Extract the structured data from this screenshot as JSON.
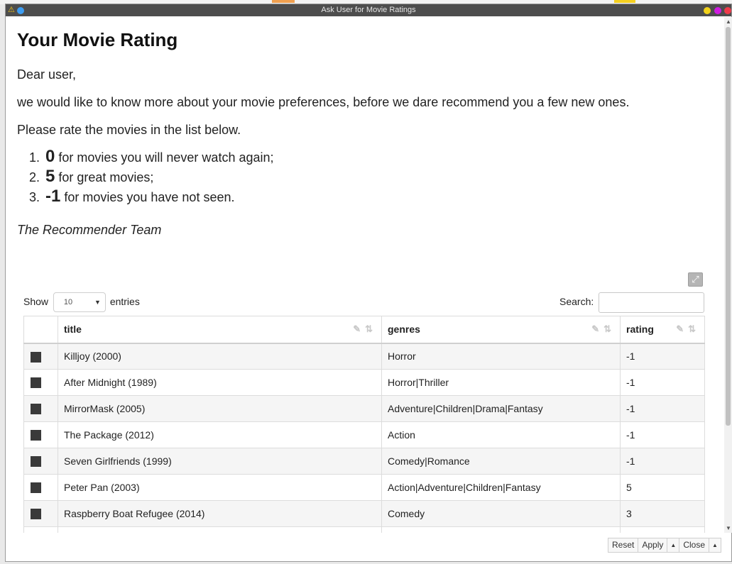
{
  "window": {
    "title": "Ask User for Movie Ratings"
  },
  "heading": "Your Movie Rating",
  "greeting": "Dear user,",
  "intro": "we would like to know more about your movie preferences, before we dare recommend you a few new ones.",
  "instruction": "Please rate the movies in the list below.",
  "rules": [
    {
      "number": "1.",
      "value": "0",
      "text": " for movies you will never watch again;"
    },
    {
      "number": "2.",
      "value": "5",
      "text": " for great movies;"
    },
    {
      "number": "3.",
      "value": "-1",
      "text": " for movies you have not seen."
    }
  ],
  "signature": "The Recommender Team",
  "table_controls": {
    "show_label": "Show",
    "entries_value": "10",
    "entries_label": "entries",
    "search_label": "Search:",
    "search_value": ""
  },
  "table": {
    "columns": [
      "",
      "title",
      "genres",
      "rating"
    ],
    "rows": [
      {
        "title": "Killjoy (2000)",
        "genres": "Horror",
        "rating": "-1"
      },
      {
        "title": "After Midnight (1989)",
        "genres": "Horror|Thriller",
        "rating": "-1"
      },
      {
        "title": "MirrorMask (2005)",
        "genres": "Adventure|Children|Drama|Fantasy",
        "rating": "-1"
      },
      {
        "title": "The Package (2012)",
        "genres": "Action",
        "rating": "-1"
      },
      {
        "title": "Seven Girlfriends (1999)",
        "genres": "Comedy|Romance",
        "rating": "-1"
      },
      {
        "title": "Peter Pan (2003)",
        "genres": "Action|Adventure|Children|Fantasy",
        "rating": "5"
      },
      {
        "title": "Raspberry Boat Refugee (2014)",
        "genres": "Comedy",
        "rating": "3"
      }
    ]
  },
  "footer": {
    "reset": "Reset",
    "apply": "Apply",
    "close": "Close"
  },
  "icons": {
    "warning": "warning-icon",
    "expand": "expand-icon",
    "edit": "pencil-icon",
    "sort": "sort-icon",
    "caret": "caret-down-icon",
    "up": "caret-up-icon"
  },
  "colors": {
    "titlebar": "#4d4d4d",
    "row_stripe": "#f5f5f5",
    "checkbox": "#3a3a3a"
  }
}
